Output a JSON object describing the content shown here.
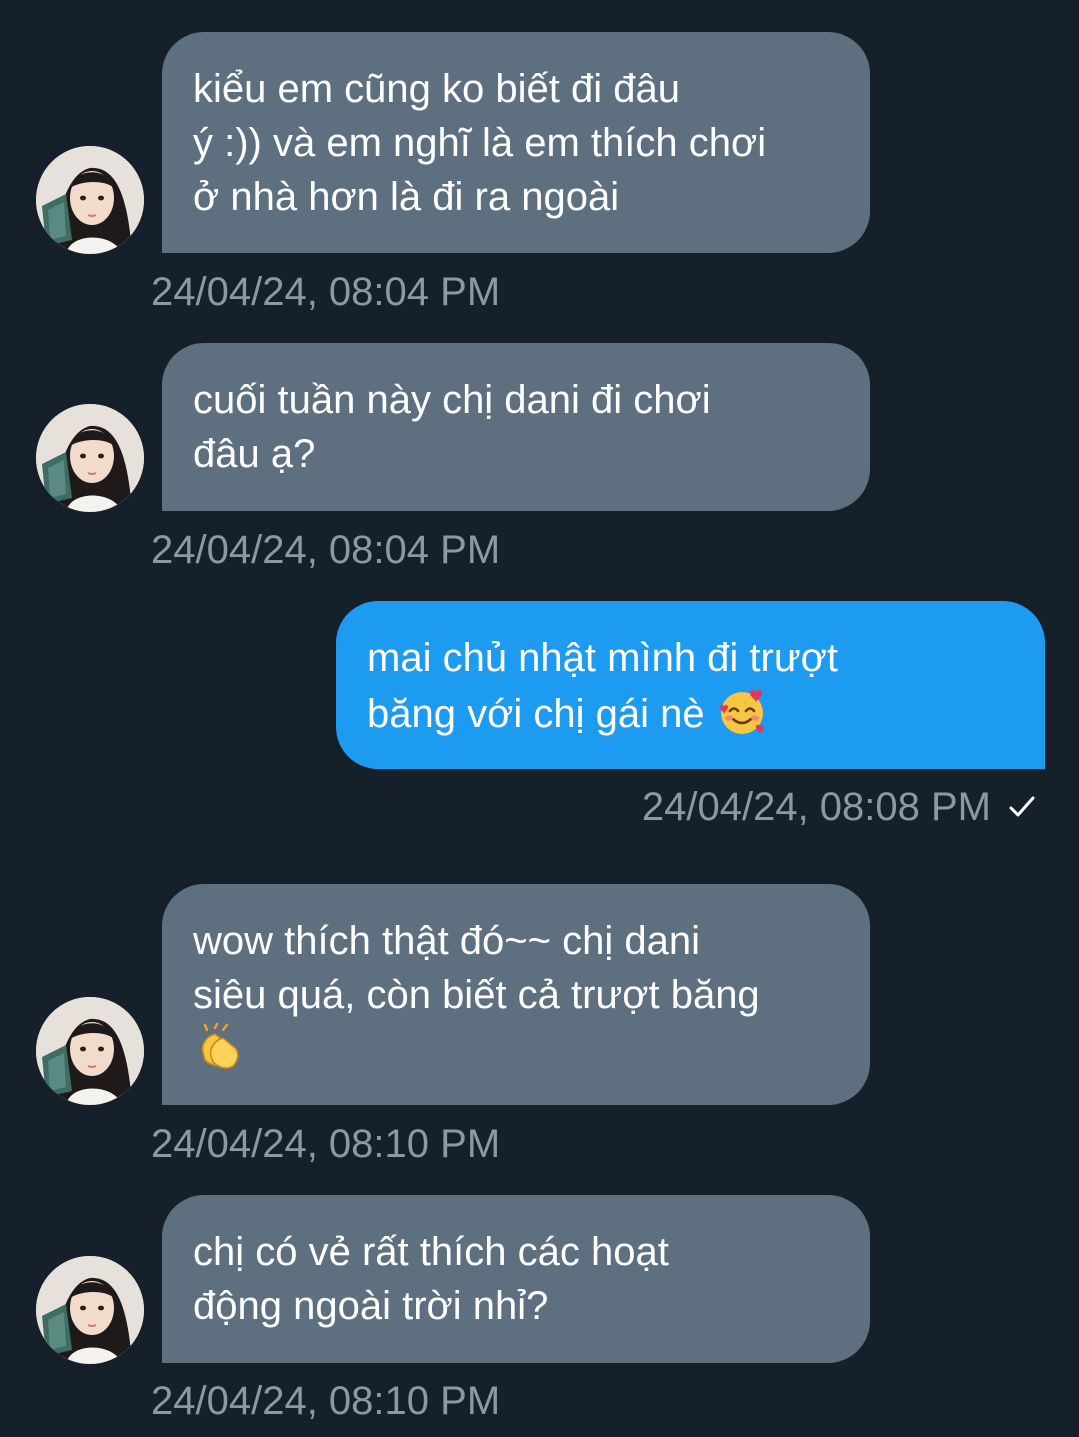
{
  "messages": [
    {
      "direction": "in",
      "lines": [
        "kiểu em cũng ko biết đi đâu",
        "ý :)) và em nghĩ là em thích chơi",
        "ở nhà hơn là đi ra ngoài"
      ],
      "timestamp": "24/04/24, 08:04 PM"
    },
    {
      "direction": "in",
      "lines": [
        "cuối tuần này chị dani đi chơi",
        "đâu ạ?"
      ],
      "timestamp": "24/04/24, 08:04 PM"
    },
    {
      "direction": "out",
      "lines": [
        "mai chủ nhật mình đi trượt",
        "băng với chị gái nè"
      ],
      "emoji": "smiling-face-with-hearts",
      "timestamp": "24/04/24, 08:08 PM",
      "status_icon": "checkmark-icon"
    },
    {
      "direction": "in",
      "lines": [
        "wow thích thật đó~~ chị dani",
        "siêu quá, còn biết cả trượt băng"
      ],
      "emoji": "clapping-hands",
      "timestamp": "24/04/24, 08:10 PM"
    },
    {
      "direction": "in",
      "lines": [
        "chị có vẻ rất thích các hoạt",
        "động ngoài trời nhỉ?"
      ],
      "timestamp": "24/04/24, 08:10 PM"
    }
  ],
  "colors": {
    "background": "#15202b",
    "incoming_bubble": "#5e6f80",
    "outgoing_bubble": "#1d9bf0",
    "timestamp_text": "#8b98a5",
    "message_text": "#ffffff"
  }
}
